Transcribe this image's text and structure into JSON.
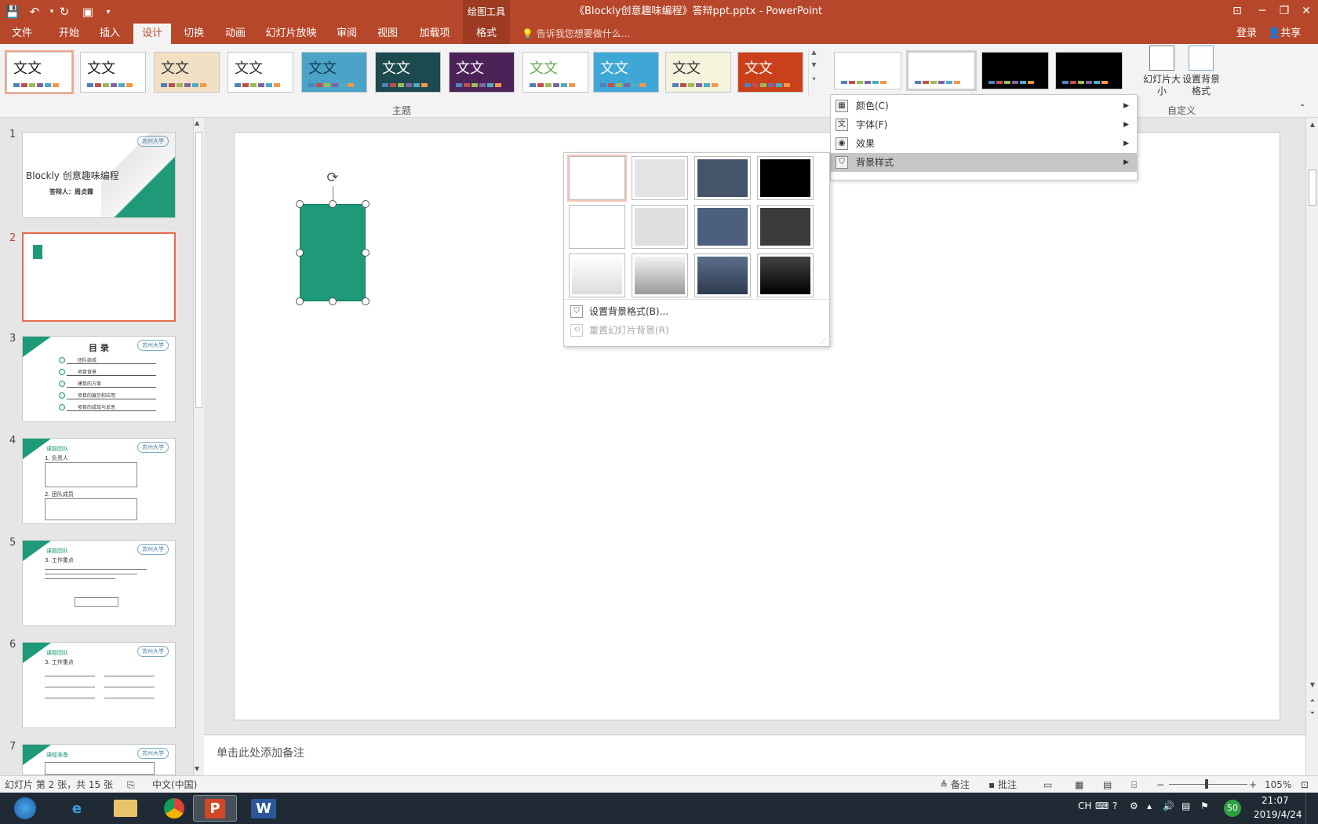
{
  "window": {
    "title": "《Blockly创意趣味编程》答辩ppt.pptx - PowerPoint",
    "contextual_group": "绘图工具",
    "quick_access": [
      "save-icon",
      "undo-icon",
      "redo-icon",
      "start-slideshow-icon",
      "customize-qat-icon"
    ],
    "controls": [
      "ribbon-display-options-icon",
      "minimize-icon",
      "restore-icon",
      "close-icon"
    ]
  },
  "ribbon": {
    "tabs": [
      "文件",
      "开始",
      "插入",
      "设计",
      "切换",
      "动画",
      "幻灯片放映",
      "审阅",
      "视图",
      "加载项",
      "格式"
    ],
    "active_tab": "设计",
    "tell_me": "告诉我您想要做什么...",
    "login": "登录",
    "share": "共享",
    "theme_thumb_text": "文文",
    "themes_group_label": "主题",
    "theme_colors": [
      {
        "bg": "#ffffff",
        "fg": "#222222"
      },
      {
        "bg": "#ffffff",
        "fg": "#222222"
      },
      {
        "bg": "#f2e0c4",
        "fg": "#333333"
      },
      {
        "bg": "#ffffff",
        "fg": "#333333"
      },
      {
        "bg": "#4ba3c7",
        "fg": "#0e3a4f"
      },
      {
        "bg": "#1d4a4e",
        "fg": "#ffffff"
      },
      {
        "bg": "#4c2359",
        "fg": "#ffffff"
      },
      {
        "bg": "#ffffff",
        "fg": "#6aa84f"
      },
      {
        "bg": "#3fa7d6",
        "fg": "#ffffff"
      },
      {
        "bg": "#f4f3dc",
        "fg": "#333333"
      },
      {
        "bg": "#c9401b",
        "fg": "#ffffff"
      }
    ],
    "variants": [
      "#ffffff",
      "#ffffff",
      "#000000",
      "#000000"
    ],
    "slide_size": "幻灯片大小",
    "format_background": "设置背景格式",
    "customize_group_label": "自定义",
    "variant_menu": [
      {
        "label": "颜色(C)",
        "icon": "colors-icon",
        "glyph": "▦"
      },
      {
        "label": "字体(F)",
        "icon": "fonts-icon",
        "glyph": "文"
      },
      {
        "label": "效果",
        "icon": "effects-icon",
        "glyph": "◉"
      },
      {
        "label": "背景样式",
        "icon": "background-styles-icon",
        "glyph": "⛉"
      }
    ]
  },
  "background_menu": {
    "swatches": [
      [
        "#ffffff",
        "#e3e4e6",
        "#44546a",
        "#000000"
      ],
      [
        "#ffffff",
        "#dedfe1",
        "#4c5f7e",
        "#3b3b3b"
      ],
      [
        "linear-gradient(#ffffff,#dcdcdc)",
        "linear-gradient(#f2f2f2,#9a9a9a)",
        "linear-gradient(#5b6e8a,#2d3a50)",
        "linear-gradient(#444,#000)"
      ]
    ],
    "format_background": "设置背景格式(B)...",
    "reset_background": "重置幻灯片背景(R)"
  },
  "slides": {
    "numbers": [
      "1",
      "2",
      "3",
      "4",
      "5",
      "6",
      "7"
    ],
    "s1_title": "Blockly 创意趣味编程",
    "s1_subtitle": "答辩人：周贞霖",
    "logo_text": "苏州大学",
    "s3_title": "目 录",
    "s3_items": [
      "团队组成",
      "项目背景",
      "建筑的方案",
      "项目的展示和应用",
      "项目的成效与反思"
    ],
    "section_label": "课题团队",
    "s4_heading1": "1. 负责人",
    "s4_heading2": "2. 团队成员",
    "s5_heading": "3. 工作重点",
    "s6_heading": "3. 工作重点",
    "s7_section": "课程准备"
  },
  "notes_placeholder": "单击此处添加备注",
  "status": {
    "slide_info": "幻灯片 第 2 张，共 15 张",
    "language": "中文(中国)",
    "notes": "备注",
    "comments": "批注",
    "zoom": "105%"
  },
  "taskbar": {
    "apps": [
      "start-icon",
      "internet-explorer-icon",
      "file-explorer-icon",
      "chrome-icon",
      "powerpoint-icon",
      "word-icon"
    ],
    "ime": "CH",
    "badge": "50",
    "time": "21:07",
    "date": "2019/4/24"
  }
}
